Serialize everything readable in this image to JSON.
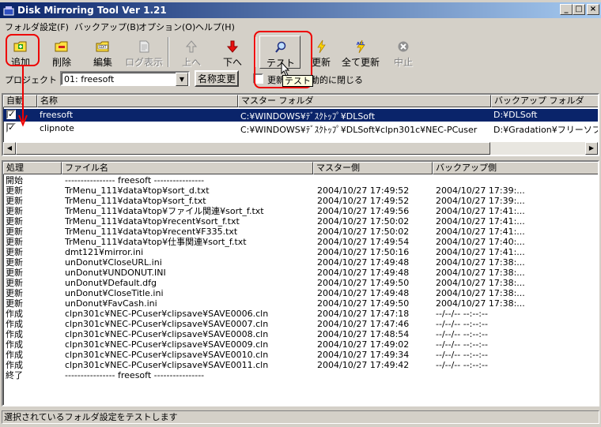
{
  "window": {
    "title": "Disk Mirroring Tool Ver 1.21",
    "minimize": "_",
    "maximize": "□",
    "close": "×"
  },
  "menu": [
    {
      "label": "フォルダ設定(F)"
    },
    {
      "label": "バックアップ(B)"
    },
    {
      "label": "オプション(O)"
    },
    {
      "label": "ヘルプ(H)"
    }
  ],
  "toolbar": {
    "add": "追加",
    "delete": "削除",
    "edit": "編集",
    "log": "ログ表示",
    "up": "上へ",
    "down": "下へ",
    "test": "テスト",
    "update": "更新",
    "update_all": "全て更新",
    "stop": "中止"
  },
  "project": {
    "label": "プロジェクト",
    "selected": "01: freesoft",
    "rename": "名称変更",
    "autoclose_label": "更新後に自動的に閉じる",
    "autoclose_checked": false
  },
  "tooltip": "テスト",
  "folders": {
    "columns": [
      "自動",
      "名称",
      "マスター フォルダ",
      "バックアップ フォルダ"
    ],
    "rows": [
      {
        "checked": true,
        "name": "freesoft",
        "master": "C:¥WINDOWS¥ﾃﾞｽｸﾄｯﾌﾟ¥DLSoft",
        "backup": "D:¥DLSoft",
        "selected": true
      },
      {
        "checked": true,
        "name": "clipnote",
        "master": "C:¥WINDOWS¥ﾃﾞｽｸﾄｯﾌﾟ¥DLSoft¥clpn301c¥NEC-PCuser",
        "backup": "D:¥Gradation¥フリーソフト¥N",
        "selected": false
      }
    ]
  },
  "log": {
    "columns": [
      "処理",
      "ファイル名",
      "マスター側",
      "バックアップ側"
    ],
    "rows": [
      [
        "開始",
        "---------------- freesoft ----------------",
        "",
        ""
      ],
      [
        "更新",
        "TrMenu_111¥data¥top¥sort_d.txt",
        "2004/10/27 17:49:52",
        "2004/10/27 17:39:..."
      ],
      [
        "更新",
        "TrMenu_111¥data¥top¥sort_f.txt",
        "2004/10/27 17:49:52",
        "2004/10/27 17:39:..."
      ],
      [
        "更新",
        "TrMenu_111¥data¥top¥ファイル関連¥sort_f.txt",
        "2004/10/27 17:49:56",
        "2004/10/27 17:41:..."
      ],
      [
        "更新",
        "TrMenu_111¥data¥top¥recent¥sort_f.txt",
        "2004/10/27 17:50:02",
        "2004/10/27 17:41:..."
      ],
      [
        "更新",
        "TrMenu_111¥data¥top¥recent¥F335.txt",
        "2004/10/27 17:50:02",
        "2004/10/27 17:41:..."
      ],
      [
        "更新",
        "TrMenu_111¥data¥top¥仕事関連¥sort_f.txt",
        "2004/10/27 17:49:54",
        "2004/10/27 17:40:..."
      ],
      [
        "更新",
        "dmt121¥mirror.ini",
        "2004/10/27 17:50:16",
        "2004/10/27 17:41:..."
      ],
      [
        "更新",
        "unDonut¥CloseURL.ini",
        "2004/10/27 17:49:48",
        "2004/10/27 17:38:..."
      ],
      [
        "更新",
        "unDonut¥UNDONUT.INI",
        "2004/10/27 17:49:48",
        "2004/10/27 17:38:..."
      ],
      [
        "更新",
        "unDonut¥Default.dfg",
        "2004/10/27 17:49:50",
        "2004/10/27 17:38:..."
      ],
      [
        "更新",
        "unDonut¥CloseTitle.ini",
        "2004/10/27 17:49:48",
        "2004/10/27 17:38:..."
      ],
      [
        "更新",
        "unDonut¥FavCash.ini",
        "2004/10/27 17:49:50",
        "2004/10/27 17:38:..."
      ],
      [
        "作成",
        "clpn301c¥NEC-PCuser¥clipsave¥SAVE0006.cln",
        "2004/10/27 17:47:18",
        "--/--/-- --:--:--"
      ],
      [
        "作成",
        "clpn301c¥NEC-PCuser¥clipsave¥SAVE0007.cln",
        "2004/10/27 17:47:46",
        "--/--/-- --:--:--"
      ],
      [
        "作成",
        "clpn301c¥NEC-PCuser¥clipsave¥SAVE0008.cln",
        "2004/10/27 17:48:54",
        "--/--/-- --:--:--"
      ],
      [
        "作成",
        "clpn301c¥NEC-PCuser¥clipsave¥SAVE0009.cln",
        "2004/10/27 17:49:02",
        "--/--/-- --:--:--"
      ],
      [
        "作成",
        "clpn301c¥NEC-PCuser¥clipsave¥SAVE0010.cln",
        "2004/10/27 17:49:34",
        "--/--/-- --:--:--"
      ],
      [
        "作成",
        "clpn301c¥NEC-PCuser¥clipsave¥SAVE0011.cln",
        "2004/10/27 17:49:42",
        "--/--/-- --:--:--"
      ],
      [
        "終了",
        "---------------- freesoft ----------------",
        "",
        ""
      ]
    ]
  },
  "status": "選択されているフォルダ設定をテストします",
  "colors": {
    "titlebar": "#0a246a",
    "selection": "#0a246a",
    "highlight_box": "#e00000"
  },
  "icons": {
    "add": "folder-plus-icon",
    "delete": "folder-minus-icon",
    "edit": "folder-edit-icon",
    "log": "document-icon",
    "up": "arrow-up-icon",
    "down": "arrow-down-icon",
    "test": "magnifier-icon",
    "update": "lightning-icon",
    "update_all": "lightning-all-icon",
    "stop": "stop-icon"
  }
}
